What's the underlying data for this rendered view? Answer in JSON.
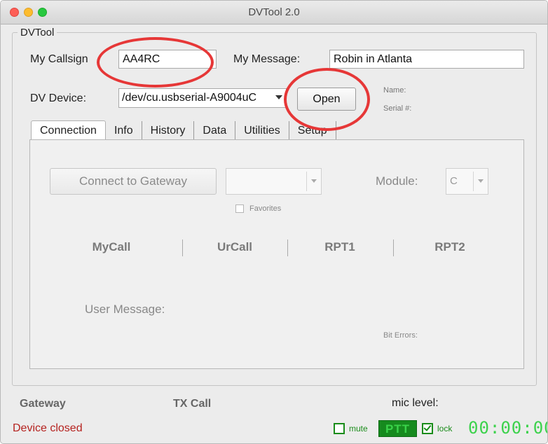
{
  "window": {
    "title": "DVTool 2.0"
  },
  "group": {
    "title": "DVTool"
  },
  "fields": {
    "callsign_label": "My Callsign",
    "callsign_value": "AA4RC",
    "message_label": "My Message:",
    "message_value": "Robin in Atlanta",
    "device_label": "DV Device:",
    "device_value": "/dev/cu.usbserial-A9004uC",
    "open_label": "Open",
    "name_label": "Name:",
    "serial_label": "Serial #:"
  },
  "tabs": [
    {
      "label": "Connection"
    },
    {
      "label": "Info"
    },
    {
      "label": "History"
    },
    {
      "label": "Data"
    },
    {
      "label": "Utilities"
    },
    {
      "label": "Setup"
    }
  ],
  "connection": {
    "connect_label": "Connect to Gateway",
    "gateway_value": "",
    "module_label": "Module:",
    "module_value": "C",
    "favorites_label": "Favorites",
    "headers": {
      "mycall": "MyCall",
      "urcall": "UrCall",
      "rpt1": "RPT1",
      "rpt2": "RPT2"
    },
    "user_message_label": "User Message:",
    "bit_errors_label": "Bit Errors:"
  },
  "status": {
    "gateway_label": "Gateway",
    "txcall_label": "TX Call",
    "mic_label": "mic level:",
    "device_status": "Device closed",
    "mute_label": "mute",
    "ptt_label": "PTT",
    "lock_label": "lock",
    "timer": "00:00:00"
  },
  "colors": {
    "annotation_circle": "#e63737",
    "status_red": "#b5221f",
    "ptt_green": "#168a1e",
    "timer_green": "#3cd24c"
  }
}
